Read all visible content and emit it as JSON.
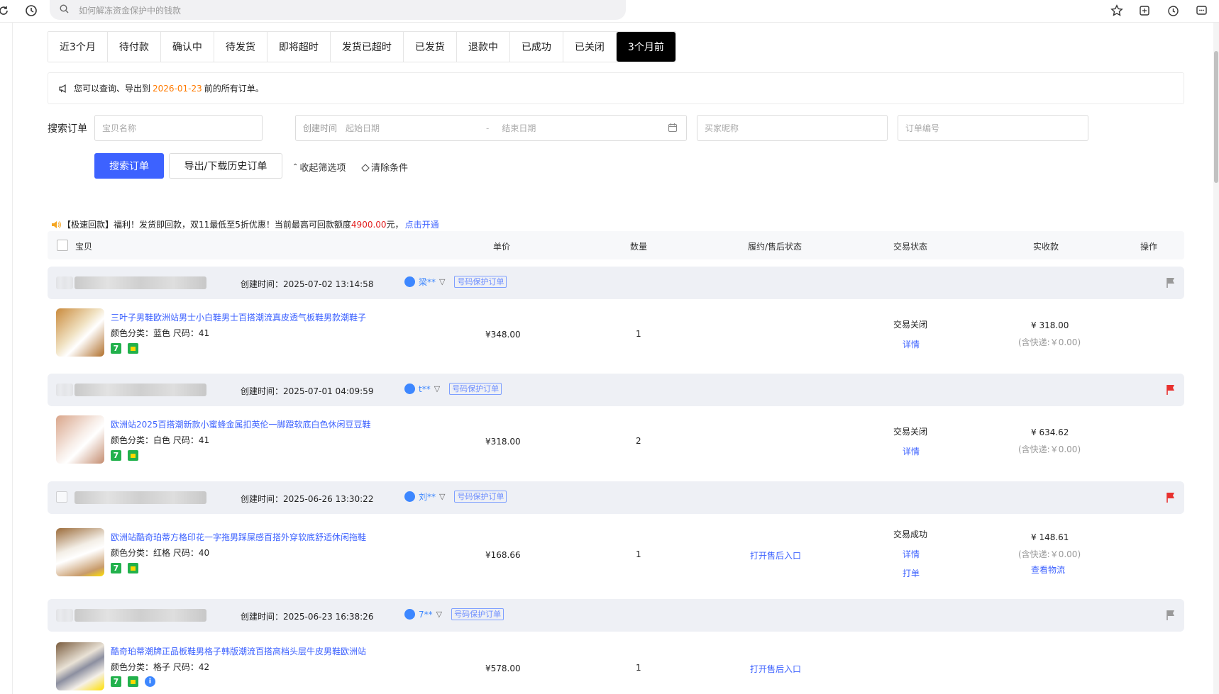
{
  "browser": {
    "search_placeholder": "如何解冻资金保护中的钱款"
  },
  "tabs": [
    {
      "label": "近3个月"
    },
    {
      "label": "待付款"
    },
    {
      "label": "确认中"
    },
    {
      "label": "待发货"
    },
    {
      "label": "即将超时"
    },
    {
      "label": "发货已超时"
    },
    {
      "label": "已发货"
    },
    {
      "label": "退款中"
    },
    {
      "label": "已成功"
    },
    {
      "label": "已关闭"
    },
    {
      "label": "3个月前",
      "active": true
    }
  ],
  "notice": {
    "prefix": "您可以查询、导出到",
    "date": "2026-01-23",
    "suffix": "前的所有订单。",
    "date_color": "#ff7a00"
  },
  "search": {
    "label": "搜索订单",
    "item_placeholder": "宝贝名称",
    "time_label": "创建时间",
    "start_placeholder": "起始日期",
    "separator": "-",
    "end_placeholder": "结束日期",
    "buyer_placeholder": "买家昵称",
    "order_placeholder": "订单编号",
    "search_button": "搜索订单",
    "export_button": "导出/下载历史订单",
    "collapse_link": "收起筛选项",
    "clear_link": "清除条件",
    "primary_color": "#3d62ff"
  },
  "promo": {
    "text": "【极速回款】福利！发货即回款，双11最低至5折优惠！当前最高可回款额度",
    "amount": "4900.00",
    "unit": "元，",
    "link": "点击开通"
  },
  "table_header": {
    "item": "宝贝",
    "unit_price": "单价",
    "quantity": "数量",
    "after_sale": "履约/售后状态",
    "trade_status": "交易状态",
    "paid": "实收款",
    "action": "操作"
  },
  "orders": [
    {
      "create_time": "创建时间：2025-07-02 13:14:58",
      "buyer": "梁**",
      "tag": "号码保护订单",
      "flag_color": "#999999",
      "title": "三叶子男鞋欧洲站男士小白鞋男士百搭潮流真皮透气板鞋男款潮鞋子",
      "attrs": "颜色分类：蓝色   尺码：41",
      "price": "¥348.00",
      "qty": "1",
      "after": "",
      "status": "交易关闭",
      "detail": "详情",
      "paid": "¥ 318.00",
      "ship": "(含快递:￥0.00)"
    },
    {
      "create_time": "创建时间：2025-07-01 04:09:59",
      "buyer": "t**",
      "tag": "号码保护订单",
      "flag_color": "#e8312f",
      "title": "欧洲站2025百搭潮新款小蜜蜂金属扣英伦一脚蹬软底白色休闲豆豆鞋",
      "attrs": "颜色分类：白色   尺码：41",
      "price": "¥318.00",
      "qty": "2",
      "after": "",
      "status": "交易关闭",
      "detail": "详情",
      "paid": "¥ 634.62",
      "ship": "(含快递:￥0.00)"
    },
    {
      "create_time": "创建时间：2025-06-26 13:30:22",
      "buyer": "刘**",
      "tag": "号码保护订单",
      "flag_color": "#e8312f",
      "title": "欧洲站酷奇珀蒂方格印花一字拖男踩屎感百搭外穿软底舒适休闲拖鞋",
      "attrs": "颜色分类：红格   尺码：40",
      "price": "¥168.66",
      "qty": "1",
      "after": "打开售后入口",
      "status": "交易成功",
      "detail": "详情",
      "print": "打单",
      "paid": "¥ 148.61",
      "ship": "(含快递:￥0.00)",
      "logistics": "查看物流"
    },
    {
      "create_time": "创建时间：2025-06-23 16:38:26",
      "buyer": "7**",
      "tag": "号码保护订单",
      "flag_color": "#999999",
      "title": "酷奇珀蒂潮牌正品板鞋男格子韩版潮流百搭高档头层牛皮男鞋欧洲站",
      "attrs": "颜色分类：格子   尺码：42",
      "price": "¥578.00",
      "qty": "1",
      "after": "打开售后入口",
      "status": "",
      "paid": "",
      "ship": ""
    }
  ]
}
